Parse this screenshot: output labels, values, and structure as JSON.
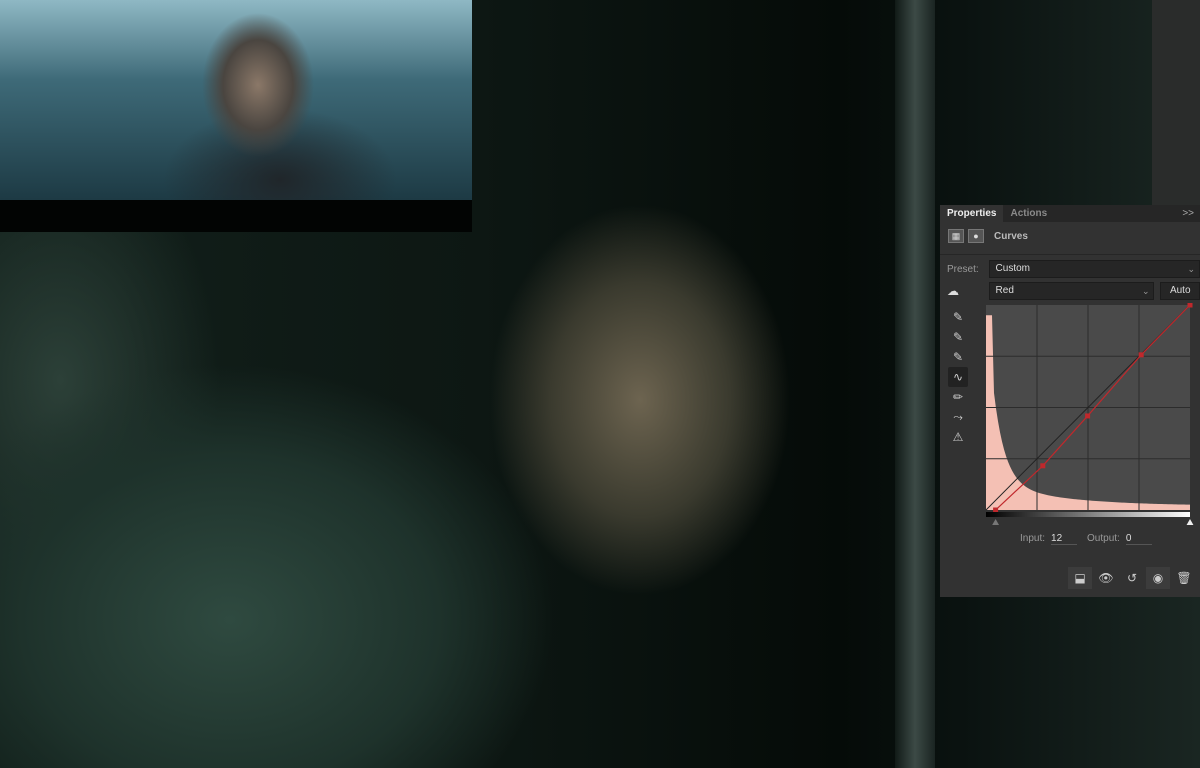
{
  "panel": {
    "tabs": [
      {
        "label": "Properties",
        "active": true
      },
      {
        "label": "Actions",
        "active": false
      }
    ],
    "collapse_icon": "double-chevron-right-icon",
    "adjustment_title": "Curves",
    "preset_label": "Preset:",
    "preset_value": "Custom",
    "channel_value": "Red",
    "auto_label": "Auto",
    "tools": [
      "on-image-adjust-icon",
      "eyedropper-black-icon",
      "eyedropper-gray-icon",
      "eyedropper-white-icon",
      "curve-points-icon",
      "pencil-icon",
      "smooth-icon",
      "clipping-warning-icon"
    ],
    "curve": {
      "channel_color": "#c0282c",
      "histogram_color": "#f4c0b4",
      "points": [
        [
          12,
          0
        ],
        [
          71,
          55
        ],
        [
          127,
          117
        ],
        [
          194,
          193
        ],
        [
          255,
          255
        ]
      ],
      "range": [
        0,
        255
      ]
    },
    "input_label": "Input:",
    "input_value": "12",
    "output_label": "Output:",
    "output_value": "0",
    "footer_icons": [
      "clip-to-layer-icon",
      "view-previous-icon",
      "reset-icon",
      "visibility-eye-icon",
      "trash-icon"
    ]
  }
}
